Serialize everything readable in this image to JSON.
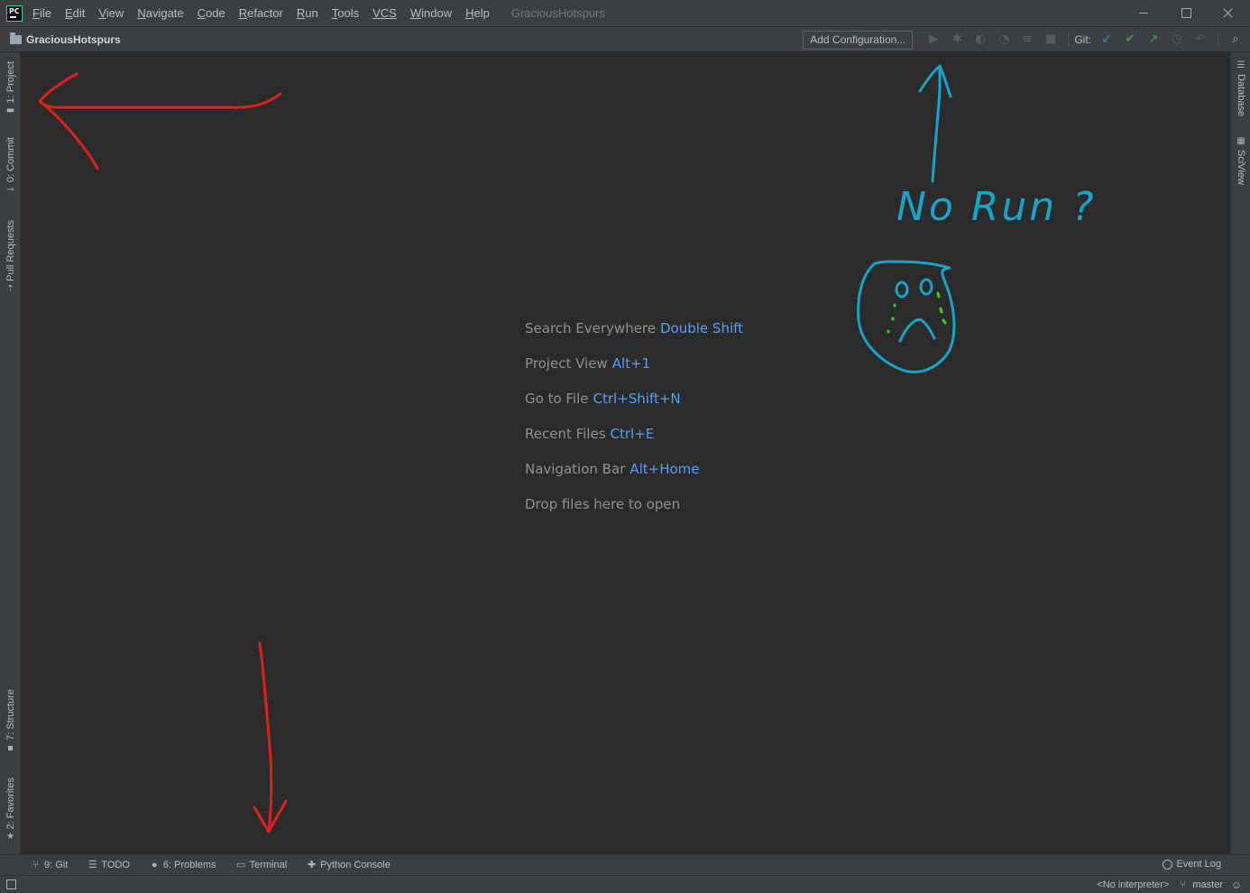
{
  "app": {
    "logo_text": "PC",
    "window_title": "GraciousHotspurs"
  },
  "menu": [
    {
      "mnemonic": "F",
      "rest": "ile"
    },
    {
      "mnemonic": "E",
      "rest": "dit"
    },
    {
      "mnemonic": "V",
      "rest": "iew"
    },
    {
      "mnemonic": "N",
      "rest": "avigate"
    },
    {
      "mnemonic": "C",
      "rest": "ode"
    },
    {
      "mnemonic": "R",
      "rest": "efactor"
    },
    {
      "mnemonic": "R",
      "rest": "un"
    },
    {
      "mnemonic": "T",
      "rest": "ools"
    },
    {
      "mnemonic": "VCS",
      "rest": ""
    },
    {
      "mnemonic": "W",
      "rest": "indow"
    },
    {
      "mnemonic": "H",
      "rest": "elp"
    }
  ],
  "navbar": {
    "project": "GraciousHotspurs",
    "add_configuration": "Add Configuration...",
    "git_label": "Git:"
  },
  "left_tool_windows": [
    {
      "label": "1: Project",
      "icon": "folder-icon"
    },
    {
      "label": "0: Commit",
      "icon": "commit-icon"
    },
    {
      "label": "Pull Requests",
      "icon": "pull-request-icon"
    },
    {
      "label": "7: Structure",
      "icon": "structure-icon"
    },
    {
      "label": "2: Favorites",
      "icon": "star-icon"
    }
  ],
  "right_tool_windows": [
    {
      "label": "Database",
      "icon": "database-icon"
    },
    {
      "label": "SciView",
      "icon": "sciview-icon"
    }
  ],
  "editor_hints": [
    {
      "label": "Search Everywhere",
      "shortcut": "Double Shift"
    },
    {
      "label": "Project View",
      "shortcut": "Alt+1"
    },
    {
      "label": "Go to File",
      "shortcut": "Ctrl+Shift+N"
    },
    {
      "label": "Recent Files",
      "shortcut": "Ctrl+E"
    },
    {
      "label": "Navigation Bar",
      "shortcut": "Alt+Home"
    },
    {
      "label": "Drop files here to open",
      "shortcut": ""
    }
  ],
  "bottom_tabs": [
    {
      "label": "9: Git",
      "icon": "git-branch-icon"
    },
    {
      "label": "TODO",
      "icon": "todo-list-icon"
    },
    {
      "label": "6: Problems",
      "icon": "problems-icon"
    },
    {
      "label": "Terminal",
      "icon": "terminal-icon"
    },
    {
      "label": "Python Console",
      "icon": "python-icon"
    }
  ],
  "event_log": "Event Log",
  "status": {
    "interpreter": "<No interpreter>",
    "branch": "master"
  },
  "annotation": {
    "text": "No Run ?",
    "colors": {
      "red": "#e0201c",
      "blue": "#1aa3c9",
      "green": "#35d12a"
    }
  }
}
